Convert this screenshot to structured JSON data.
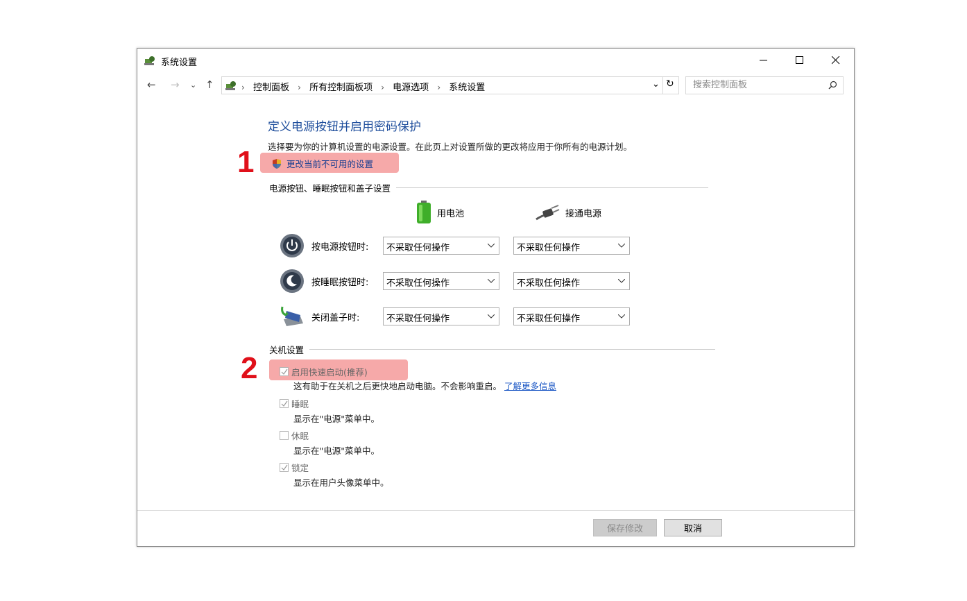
{
  "window": {
    "title": "系统设置",
    "controls": {
      "minimize": "—",
      "maximize": "☐",
      "close": "✕"
    }
  },
  "address": {
    "breadcrumbs": [
      "控制面板",
      "所有控制面板项",
      "电源选项",
      "系统设置"
    ],
    "search_placeholder": "搜索控制面板"
  },
  "content": {
    "heading": "定义电源按钮并启用密码保护",
    "description": "选择要为你的计算机设置的电源设置。在此页上对设置所做的更改将应用于你所有的电源计划。",
    "change_link": "更改当前不可用的设置",
    "section1_title": "电源按钮、睡眠按钮和盖子设置",
    "column_battery": "用电池",
    "column_plugged": "接通电源",
    "rows": [
      {
        "label": "按电源按钮时:",
        "battery": "不采取任何操作",
        "plugged": "不采取任何操作",
        "icon": "power-button-icon"
      },
      {
        "label": "按睡眠按钮时:",
        "battery": "不采取任何操作",
        "plugged": "不采取任何操作",
        "icon": "sleep-button-icon"
      },
      {
        "label": "关闭盖子时:",
        "battery": "不采取任何操作",
        "plugged": "不采取任何操作",
        "icon": "laptop-lid-icon"
      }
    ],
    "section2_title": "关机设置",
    "shutdown": [
      {
        "label": "启用快速启动(推荐)",
        "checked": true,
        "desc": "这有助于在关机之后更快地启动电脑。不会影响重启。",
        "link": "了解更多信息"
      },
      {
        "label": "睡眠",
        "checked": true,
        "desc": "显示在\"电源\"菜单中。"
      },
      {
        "label": "休眠",
        "checked": false,
        "desc": "显示在\"电源\"菜单中。"
      },
      {
        "label": "锁定",
        "checked": true,
        "desc": "显示在用户头像菜单中。"
      }
    ]
  },
  "annotations": {
    "marker1": "1",
    "marker2": "2",
    "highlight_color": "#f59a9a",
    "marker_color": "#e0101a"
  },
  "footer": {
    "save": "保存修改",
    "cancel": "取消"
  }
}
